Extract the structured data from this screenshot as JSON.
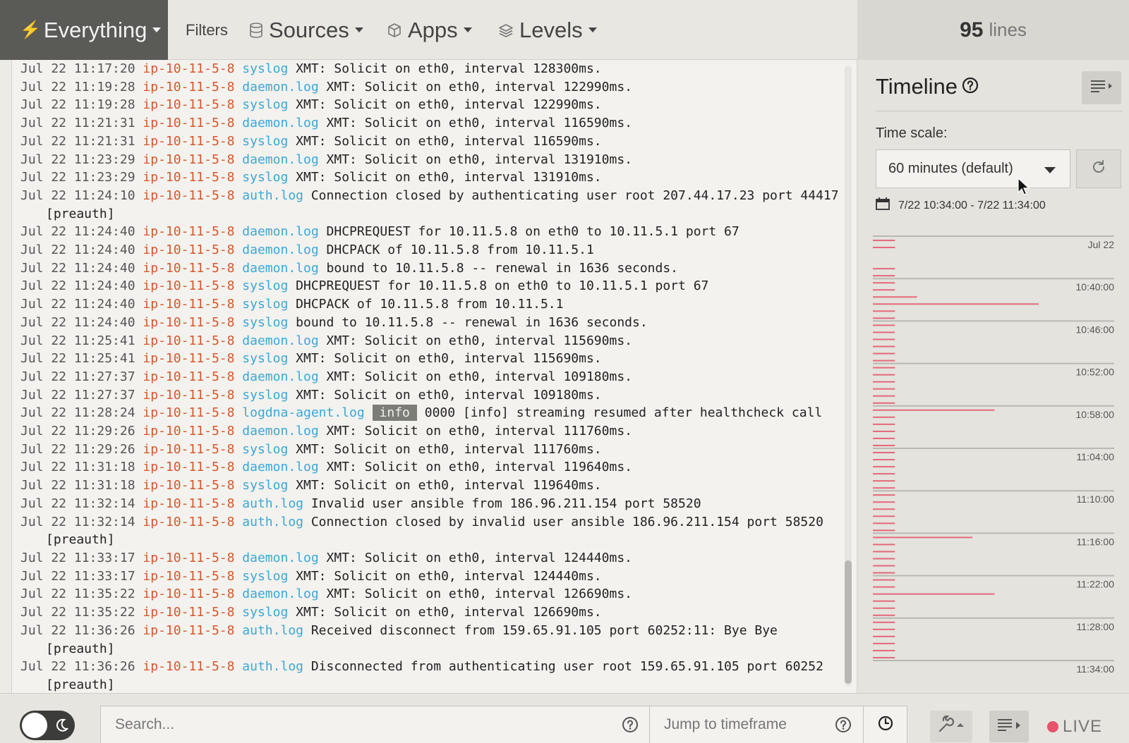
{
  "topbar": {
    "everything_label": "Everything",
    "filters_label": "Filters",
    "sources_label": "Sources",
    "apps_label": "Apps",
    "levels_label": "Levels",
    "line_count": "95",
    "line_count_unit": "lines"
  },
  "logs": [
    {
      "ts": "Jul 22 11:17:20",
      "host": "ip-10-11-5-8",
      "app": "syslog",
      "msg": "XMT: Solicit on eth0, interval 128300ms."
    },
    {
      "ts": "Jul 22 11:19:28",
      "host": "ip-10-11-5-8",
      "app": "daemon.log",
      "msg": "XMT: Solicit on eth0, interval 122990ms."
    },
    {
      "ts": "Jul 22 11:19:28",
      "host": "ip-10-11-5-8",
      "app": "syslog",
      "msg": "XMT: Solicit on eth0, interval 122990ms."
    },
    {
      "ts": "Jul 22 11:21:31",
      "host": "ip-10-11-5-8",
      "app": "daemon.log",
      "msg": "XMT: Solicit on eth0, interval 116590ms."
    },
    {
      "ts": "Jul 22 11:21:31",
      "host": "ip-10-11-5-8",
      "app": "syslog",
      "msg": "XMT: Solicit on eth0, interval 116590ms."
    },
    {
      "ts": "Jul 22 11:23:29",
      "host": "ip-10-11-5-8",
      "app": "daemon.log",
      "msg": "XMT: Solicit on eth0, interval 131910ms."
    },
    {
      "ts": "Jul 22 11:23:29",
      "host": "ip-10-11-5-8",
      "app": "syslog",
      "msg": "XMT: Solicit on eth0, interval 131910ms."
    },
    {
      "ts": "Jul 22 11:24:10",
      "host": "ip-10-11-5-8",
      "app": "auth.log",
      "msg": "Connection closed by authenticating user root 207.44.17.23 port 44417 [preauth]"
    },
    {
      "ts": "Jul 22 11:24:40",
      "host": "ip-10-11-5-8",
      "app": "daemon.log",
      "msg": "DHCPREQUEST for 10.11.5.8 on eth0 to 10.11.5.1 port 67"
    },
    {
      "ts": "Jul 22 11:24:40",
      "host": "ip-10-11-5-8",
      "app": "daemon.log",
      "msg": "DHCPACK of 10.11.5.8 from 10.11.5.1"
    },
    {
      "ts": "Jul 22 11:24:40",
      "host": "ip-10-11-5-8",
      "app": "daemon.log",
      "msg": "bound to 10.11.5.8 -- renewal in 1636 seconds."
    },
    {
      "ts": "Jul 22 11:24:40",
      "host": "ip-10-11-5-8",
      "app": "syslog",
      "msg": "DHCPREQUEST for 10.11.5.8 on eth0 to 10.11.5.1 port 67"
    },
    {
      "ts": "Jul 22 11:24:40",
      "host": "ip-10-11-5-8",
      "app": "syslog",
      "msg": "DHCPACK of 10.11.5.8 from 10.11.5.1"
    },
    {
      "ts": "Jul 22 11:24:40",
      "host": "ip-10-11-5-8",
      "app": "syslog",
      "msg": "bound to 10.11.5.8 -- renewal in 1636 seconds."
    },
    {
      "ts": "Jul 22 11:25:41",
      "host": "ip-10-11-5-8",
      "app": "daemon.log",
      "msg": "XMT: Solicit on eth0, interval 115690ms."
    },
    {
      "ts": "Jul 22 11:25:41",
      "host": "ip-10-11-5-8",
      "app": "syslog",
      "msg": "XMT: Solicit on eth0, interval 115690ms."
    },
    {
      "ts": "Jul 22 11:27:37",
      "host": "ip-10-11-5-8",
      "app": "daemon.log",
      "msg": "XMT: Solicit on eth0, interval 109180ms."
    },
    {
      "ts": "Jul 22 11:27:37",
      "host": "ip-10-11-5-8",
      "app": "syslog",
      "msg": "XMT: Solicit on eth0, interval 109180ms."
    },
    {
      "ts": "Jul 22 11:28:24",
      "host": "ip-10-11-5-8",
      "app": "logdna-agent.log",
      "level": "info",
      "msg": "0000 [info] streaming resumed after healthcheck call"
    },
    {
      "ts": "Jul 22 11:29:26",
      "host": "ip-10-11-5-8",
      "app": "daemon.log",
      "msg": "XMT: Solicit on eth0, interval 111760ms."
    },
    {
      "ts": "Jul 22 11:29:26",
      "host": "ip-10-11-5-8",
      "app": "syslog",
      "msg": "XMT: Solicit on eth0, interval 111760ms."
    },
    {
      "ts": "Jul 22 11:31:18",
      "host": "ip-10-11-5-8",
      "app": "daemon.log",
      "msg": "XMT: Solicit on eth0, interval 119640ms."
    },
    {
      "ts": "Jul 22 11:31:18",
      "host": "ip-10-11-5-8",
      "app": "syslog",
      "msg": "XMT: Solicit on eth0, interval 119640ms."
    },
    {
      "ts": "Jul 22 11:32:14",
      "host": "ip-10-11-5-8",
      "app": "auth.log",
      "msg": "Invalid user ansible from 186.96.211.154 port 58520"
    },
    {
      "ts": "Jul 22 11:32:14",
      "host": "ip-10-11-5-8",
      "app": "auth.log",
      "msg": "Connection closed by invalid user ansible 186.96.211.154 port 58520 [preauth]"
    },
    {
      "ts": "Jul 22 11:33:17",
      "host": "ip-10-11-5-8",
      "app": "daemon.log",
      "msg": "XMT: Solicit on eth0, interval 124440ms."
    },
    {
      "ts": "Jul 22 11:33:17",
      "host": "ip-10-11-5-8",
      "app": "syslog",
      "msg": "XMT: Solicit on eth0, interval 124440ms."
    },
    {
      "ts": "Jul 22 11:35:22",
      "host": "ip-10-11-5-8",
      "app": "daemon.log",
      "msg": "XMT: Solicit on eth0, interval 126690ms."
    },
    {
      "ts": "Jul 22 11:35:22",
      "host": "ip-10-11-5-8",
      "app": "syslog",
      "msg": "XMT: Solicit on eth0, interval 126690ms."
    },
    {
      "ts": "Jul 22 11:36:26",
      "host": "ip-10-11-5-8",
      "app": "auth.log",
      "msg": "Received disconnect from 159.65.91.105 port 60252:11: Bye Bye [preauth]"
    },
    {
      "ts": "Jul 22 11:36:26",
      "host": "ip-10-11-5-8",
      "app": "auth.log",
      "msg": "Disconnected from authenticating user root 159.65.91.105 port 60252 [preauth]"
    }
  ],
  "timeline": {
    "title": "Timeline",
    "time_scale_label": "Time scale:",
    "time_scale_value": "60 minutes (default)",
    "range": "7/22 10:34:00 - 7/22 11:34:00",
    "day_label": "Jul 22",
    "tick_labels": [
      "10:40:00",
      "10:46:00",
      "10:52:00",
      "10:58:00",
      "11:04:00",
      "11:10:00",
      "11:16:00",
      "11:22:00",
      "11:28:00",
      "11:34:00"
    ],
    "bar_color": "#e5546a",
    "max_count": 15,
    "counts": [
      2,
      2,
      0,
      0,
      2,
      2,
      2,
      2,
      4,
      15,
      2,
      2,
      2,
      2,
      2,
      2,
      2,
      2,
      2,
      2,
      2,
      2,
      2,
      2,
      11,
      2,
      2,
      2,
      2,
      2,
      2,
      2,
      2,
      2,
      2,
      2,
      2,
      2,
      2,
      2,
      2,
      2,
      9,
      2,
      2,
      2,
      2,
      2,
      2,
      2,
      11,
      2,
      2,
      2,
      2,
      2,
      2,
      2,
      2,
      2
    ]
  },
  "bottombar": {
    "search_placeholder": "Search...",
    "jump_placeholder": "Jump to timeframe",
    "live_label": "LIVE"
  }
}
